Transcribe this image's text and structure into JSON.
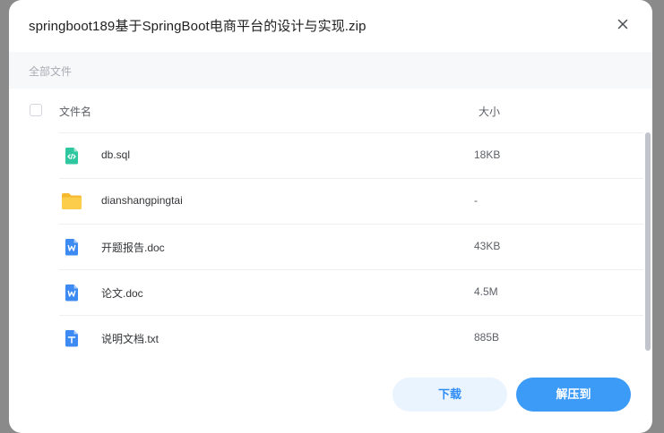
{
  "dialog": {
    "title": "springboot189基于SpringBoot电商平台的设计与实现.zip"
  },
  "breadcrumb": {
    "label": "全部文件"
  },
  "table": {
    "name_header": "文件名",
    "size_header": "大小",
    "rows": [
      {
        "icon": "code-file-icon",
        "name": "db.sql",
        "size": "18KB"
      },
      {
        "icon": "folder-icon",
        "name": "dianshangpingtai",
        "size": "-"
      },
      {
        "icon": "word-doc-icon",
        "name": "开题报告.doc",
        "size": "43KB"
      },
      {
        "icon": "word-doc-icon",
        "name": "论文.doc",
        "size": "4.5M"
      },
      {
        "icon": "text-file-icon",
        "name": "说明文档.txt",
        "size": "885B"
      }
    ]
  },
  "buttons": {
    "download": "下载",
    "extract": "解压到"
  },
  "colors": {
    "accent": "#3b9bf7",
    "code_icon": "#2ec7a0",
    "folder_icon": "#f7c23a",
    "word_icon": "#3d8bf2",
    "text_icon": "#3d8bf2"
  }
}
